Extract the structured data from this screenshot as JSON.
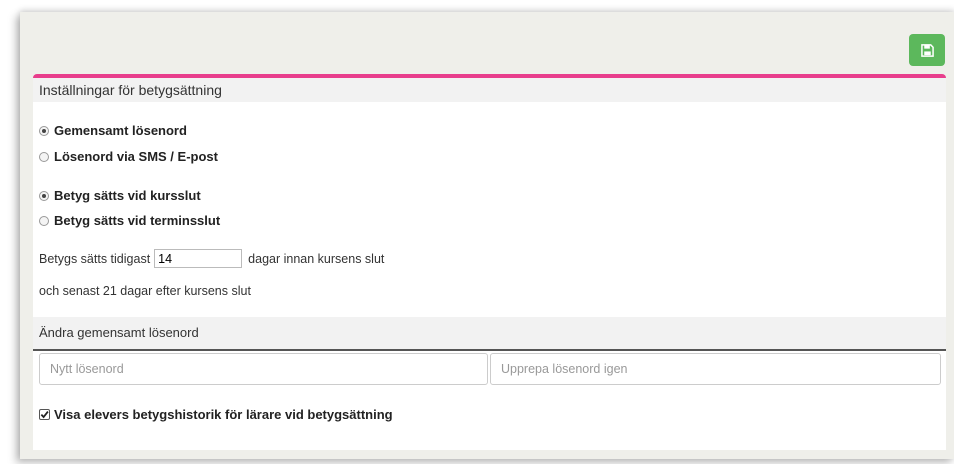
{
  "toolbar": {
    "save_icon": "floppy-disk-icon",
    "save_color": "#5cb85c"
  },
  "settings": {
    "title": "Inställningar för betygsättning",
    "accent_color": "#e83e8c",
    "password_mode": {
      "options": [
        "Gemensamt lösenord",
        "Lösenord via SMS / E-post"
      ],
      "selected": "Gemensamt lösenord"
    },
    "grading_time": {
      "options": [
        "Betyg sätts vid kursslut",
        "Betyg sätts vid terminsslut"
      ],
      "selected": "Betyg sätts vid kursslut"
    },
    "earliest_prefix": "Betygs sätts tidigast",
    "earliest_days": "14",
    "earliest_suffix": "dagar innan kursens slut",
    "latest_text": "och senast 21 dagar efter kursens slut"
  },
  "password_change": {
    "title": "Ändra gemensamt lösenord",
    "new_placeholder": "Nytt lösenord",
    "repeat_placeholder": "Upprepa lösenord igen"
  },
  "history": {
    "label": "Visa elevers betygshistorik för lärare vid betygsättning",
    "checked": true
  }
}
